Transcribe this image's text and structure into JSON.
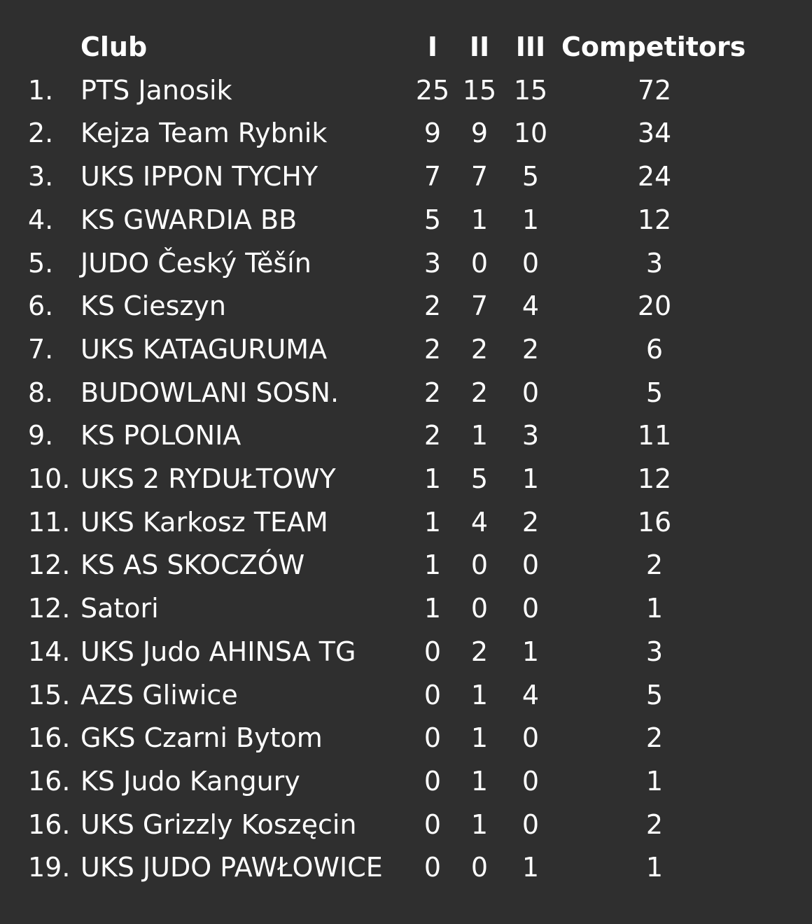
{
  "header": {
    "club": "Club",
    "gold": "I",
    "silver": "II",
    "bronze": "III",
    "competitors": "Competitors"
  },
  "rows": [
    {
      "rank": "1.",
      "club": "PTS Janosik",
      "gold": "25",
      "silver": "15",
      "bronze": "15",
      "competitors": "72"
    },
    {
      "rank": "2.",
      "club": "Kejza Team Rybnik",
      "gold": "9",
      "silver": "9",
      "bronze": "10",
      "competitors": "34"
    },
    {
      "rank": "3.",
      "club": "UKS IPPON TYCHY",
      "gold": "7",
      "silver": "7",
      "bronze": "5",
      "competitors": "24"
    },
    {
      "rank": "4.",
      "club": "KS GWARDIA BB",
      "gold": "5",
      "silver": "1",
      "bronze": "1",
      "competitors": "12"
    },
    {
      "rank": "5.",
      "club": "JUDO Český Těšín",
      "gold": "3",
      "silver": "0",
      "bronze": "0",
      "competitors": "3"
    },
    {
      "rank": "6.",
      "club": "KS Cieszyn",
      "gold": "2",
      "silver": "7",
      "bronze": "4",
      "competitors": "20"
    },
    {
      "rank": "7.",
      "club": "UKS KATAGURUMA",
      "gold": "2",
      "silver": "2",
      "bronze": "2",
      "competitors": "6"
    },
    {
      "rank": "8.",
      "club": "BUDOWLANI SOSN.",
      "gold": "2",
      "silver": "2",
      "bronze": "0",
      "competitors": "5"
    },
    {
      "rank": "9.",
      "club": "KS POLONIA",
      "gold": "2",
      "silver": "1",
      "bronze": "3",
      "competitors": "11"
    },
    {
      "rank": "10.",
      "club": "UKS 2 RYDUŁTOWY",
      "gold": "1",
      "silver": "5",
      "bronze": "1",
      "competitors": "12"
    },
    {
      "rank": "11.",
      "club": "UKS Karkosz TEAM",
      "gold": "1",
      "silver": "4",
      "bronze": "2",
      "competitors": "16"
    },
    {
      "rank": "12.",
      "club": "KS AS SKOCZÓW",
      "gold": "1",
      "silver": "0",
      "bronze": "0",
      "competitors": "2"
    },
    {
      "rank": "12.",
      "club": "Satori",
      "gold": "1",
      "silver": "0",
      "bronze": "0",
      "competitors": "1"
    },
    {
      "rank": "14.",
      "club": "UKS Judo AHINSA TG",
      "gold": "0",
      "silver": "2",
      "bronze": "1",
      "competitors": "3"
    },
    {
      "rank": "15.",
      "club": "AZS Gliwice",
      "gold": "0",
      "silver": "1",
      "bronze": "4",
      "competitors": "5"
    },
    {
      "rank": "16.",
      "club": "GKS Czarni Bytom",
      "gold": "0",
      "silver": "1",
      "bronze": "0",
      "competitors": "2"
    },
    {
      "rank": "16.",
      "club": "KS Judo Kangury",
      "gold": "0",
      "silver": "1",
      "bronze": "0",
      "competitors": "1"
    },
    {
      "rank": "16.",
      "club": "UKS Grizzly Koszęcin",
      "gold": "0",
      "silver": "1",
      "bronze": "0",
      "competitors": "2"
    },
    {
      "rank": "19.",
      "club": "UKS JUDO PAWŁOWICE",
      "gold": "0",
      "silver": "0",
      "bronze": "1",
      "competitors": "1"
    }
  ]
}
